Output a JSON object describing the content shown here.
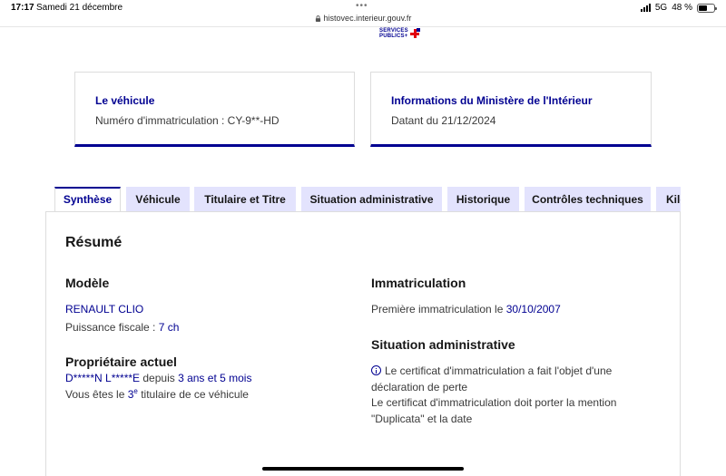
{
  "status_bar": {
    "time": "17:17",
    "date": "Samedi 21 décembre",
    "url": "histovec.interieur.gouv.fr",
    "network": "5G",
    "battery": "48 %",
    "battery_level": 0.48
  },
  "logo": {
    "line1": "SERVICES",
    "line2": "PUBLICS+"
  },
  "cards": {
    "vehicle": {
      "title": "Le véhicule",
      "text": "Numéro d'immatriculation : CY-9**-HD"
    },
    "ministry": {
      "title": "Informations du Ministère de l'Intérieur",
      "text": "Datant du 21/12/2024"
    }
  },
  "tabs": [
    "Synthèse",
    "Véhicule",
    "Titulaire et Titre",
    "Situation administrative",
    "Historique",
    "Contrôles techniques",
    "Kilo"
  ],
  "summary": {
    "title": "Résumé",
    "model": {
      "heading": "Modèle",
      "name": "RENAULT CLIO",
      "power_label": "Puissance fiscale : ",
      "power_value": "7 ch"
    },
    "owner": {
      "heading": "Propriétaire actuel",
      "name": "D*****N L*****E",
      "since_label": " depuis ",
      "since_value": "3 ans et 5 mois",
      "rank_prefix": "Vous êtes le ",
      "rank_number": "3",
      "rank_sup": "e",
      "rank_suffix": " titulaire de ce véhicule"
    },
    "registration": {
      "heading": "Immatriculation",
      "label": "Première immatriculation le ",
      "date": "30/10/2007"
    },
    "admin": {
      "heading": "Situation administrative",
      "line1": "Le certificat d'immatriculation a fait l'objet d'une",
      "line2": "déclaration de perte",
      "line3": "Le certificat d'immatriculation doit porter la mention",
      "line4": "\"Duplicata\" et la date"
    }
  }
}
